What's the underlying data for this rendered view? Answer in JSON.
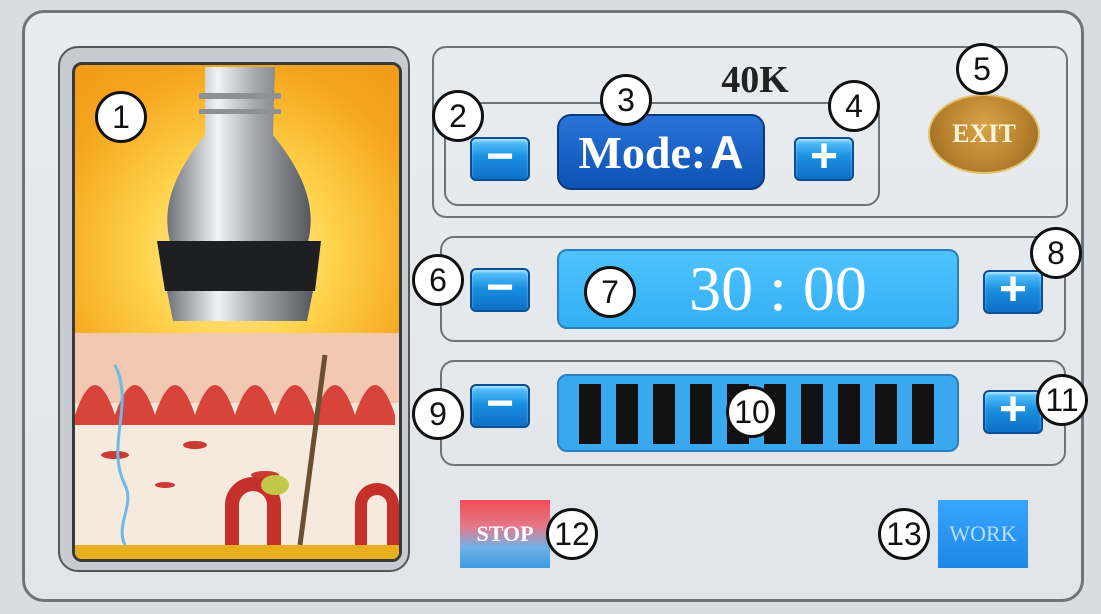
{
  "header": {
    "frequency_label": "40K"
  },
  "mode": {
    "prefix": "Mode:",
    "value": "A",
    "decrease_label": "−",
    "increase_label": "+"
  },
  "timer": {
    "value": "30 : 00",
    "decrease_label": "−",
    "increase_label": "+"
  },
  "intensity": {
    "bars_total": 10,
    "decrease_label": "−",
    "increase_label": "+"
  },
  "buttons": {
    "exit_label": "EXIT",
    "stop_label": "STOP",
    "work_label": "WORK"
  },
  "callouts": [
    "1",
    "2",
    "3",
    "4",
    "5",
    "6",
    "7",
    "8",
    "9",
    "10",
    "11",
    "12",
    "13"
  ],
  "icons": [
    "ultrasonic-probe-icon",
    "skin-cross-section-icon"
  ],
  "colors": {
    "accent_blue": "#1a8fe0",
    "display_blue": "#4ec3ff",
    "exit_gold": "#b67f2c",
    "stop_red": "#f04e57"
  }
}
